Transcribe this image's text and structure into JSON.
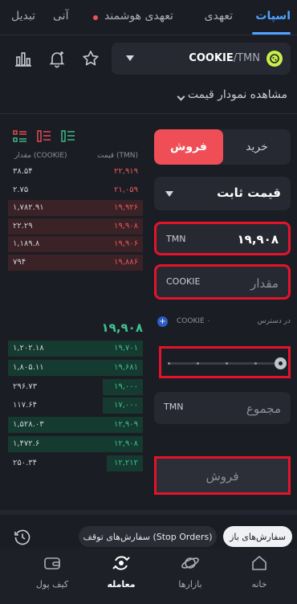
{
  "tabs": [
    {
      "label": "اسپات",
      "active": true
    },
    {
      "label": "تعهدی",
      "active": false
    },
    {
      "label": "تعهدی هوشمند",
      "active": false,
      "dot": true
    },
    {
      "label": "آنی",
      "active": false
    },
    {
      "label": "تبدیل",
      "active": false
    }
  ],
  "pair": {
    "base": "COOKIE",
    "quote": "/TMN",
    "icon": "cookie-coin-icon"
  },
  "toolbar": {
    "icons": [
      "chart-bars-icon",
      "bell-plus-icon",
      "star-icon"
    ]
  },
  "chart_link": "مشاهده نمودار قیمت",
  "order_book": {
    "price_header": "قیمت (TMN)",
    "amount_header": "مقدار (COOKIE)",
    "asks": [
      {
        "price": "۲۲,۹۱۹",
        "amount": "۳۸.۵۴",
        "depth": 0.0
      },
      {
        "price": "۲۱,۰۵۹",
        "amount": "۲.۷۵",
        "depth": 0.0
      },
      {
        "price": "۱۹,۹۲۶",
        "amount": "۱,۷۸۲.۹۱",
        "depth": 1.0
      },
      {
        "price": "۱۹,۹۰۸",
        "amount": "۲۲.۲۹",
        "depth": 1.0
      },
      {
        "price": "۱۹,۹۰۶",
        "amount": "۱,۱۸۹.۸",
        "depth": 1.0
      },
      {
        "price": "۱۹,۸۸۶",
        "amount": "۷۹۴",
        "depth": 1.0
      }
    ],
    "last_price": "۱۹,۹۰۸",
    "bids": [
      {
        "price": "۱۹,۷۰۱",
        "amount": "۱,۲۰۲.۱۸",
        "depth": 1.0
      },
      {
        "price": "۱۹,۶۸۱",
        "amount": "۱,۸۰۵.۱۱",
        "depth": 1.0
      },
      {
        "price": "۱۹,۰۰۰",
        "amount": "۲۹۶.۷۳",
        "depth": 0.3
      },
      {
        "price": "۱۷,۰۰۰",
        "amount": "۱۱۷.۶۴",
        "depth": 0.3
      },
      {
        "price": "۱۲,۹۰۹",
        "amount": "۱,۵۲۸.۰۳",
        "depth": 1.0
      },
      {
        "price": "۱۲,۹۰۸",
        "amount": "۱,۴۷۲.۶",
        "depth": 1.0
      },
      {
        "price": "۱۲,۲۱۲",
        "amount": "۲۵۰.۳۴",
        "depth": 0.27
      }
    ]
  },
  "form": {
    "buy_label": "خرید",
    "sell_label": "فروش",
    "order_type": "قیمت ثابت",
    "price_unit": "TMN",
    "price_value": "۱۹,۹۰۸",
    "amount_unit": "COOKIE",
    "amount_placeholder": "مقدار",
    "available_label": "در دسترس",
    "available_value": "COOKIE ۰",
    "slider_level": 1.0,
    "total_unit": "TMN",
    "total_placeholder": "مجموع",
    "submit_label": "فروش"
  },
  "orders": {
    "open_label": "سفارش‌های باز",
    "stop_label": "سفارش‌های توقف (Stop Orders)"
  },
  "nav": [
    {
      "label": "خانه",
      "icon": "home-icon",
      "active": false
    },
    {
      "label": "بازارها",
      "icon": "planet-icon",
      "active": false
    },
    {
      "label": "معامله",
      "icon": "trade-icon",
      "active": true
    },
    {
      "label": "کیف پول",
      "icon": "wallet-icon",
      "active": false
    }
  ],
  "colors": {
    "accent": "#4da3ff",
    "sell": "#f04e56",
    "buy": "#3ec28f",
    "highlight": "#e3132b"
  }
}
